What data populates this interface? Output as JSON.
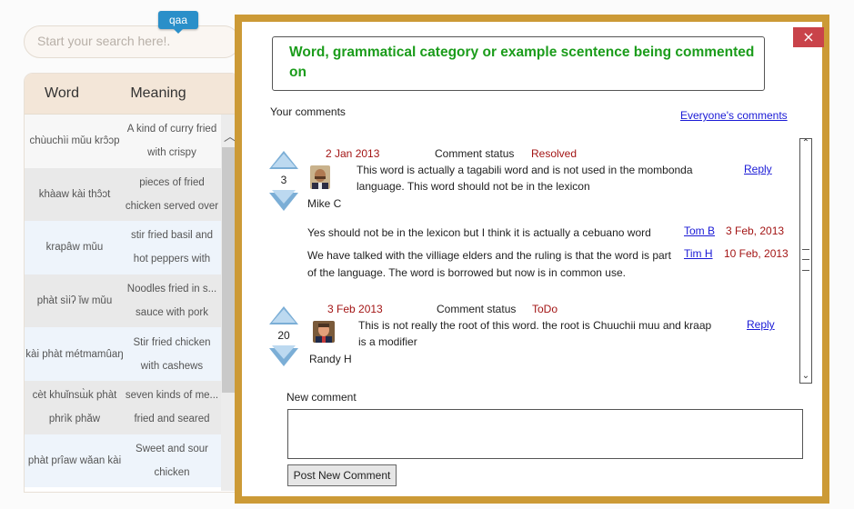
{
  "background": {
    "search_placeholder": "Start your search here!.",
    "badge": "qaa",
    "table": {
      "headers": {
        "word": "Word",
        "meaning": "Meaning"
      },
      "rows": [
        {
          "word": "chùuchìi mǔu krɔ̂ɔp",
          "meaning": "A kind of curry fried with crispy"
        },
        {
          "word": "khàaw kài thɔ̂ɔt",
          "meaning": "pieces of fried chicken served over"
        },
        {
          "word": "krapâw mǔu",
          "meaning": "stir fried basil and hot peppers with"
        },
        {
          "word": "phàt sìiʔ ǐw mǔu",
          "meaning": "Noodles fried in s... sauce with pork"
        },
        {
          "word": "kài phàt métmamûaŋ",
          "meaning": "Stir fried chicken with cashews"
        },
        {
          "word": "cèt khuǐnsɯ̀k phàt phrìk phǎw",
          "meaning": "seven kinds of me... fried and seared"
        },
        {
          "word": "phàt prîaw wǎan kài",
          "meaning": "Sweet and sour chicken"
        }
      ]
    }
  },
  "modal": {
    "close_label": "×",
    "subject": "Word, grammatical category or example scentence being commented on",
    "your_comments_label": "Your comments",
    "everyones_comments_link": "Everyone's comments",
    "comments": [
      {
        "date": "2 Jan 2013",
        "status_label": "Comment status",
        "status": "Resolved",
        "votes": "3",
        "author": "Mike C",
        "text": "This word is actually a tagabili word and is not used in the mombonda language. This word should not be in the lexicon",
        "reply_label": "Reply",
        "replies": [
          {
            "text": "Yes should not be in the lexicon but I think it is actually a cebuano word",
            "author": "Tom B",
            "date": "3 Feb, 2013"
          },
          {
            "text": "We have talked with the villiage elders and the ruling is that the word is part of the language. The word is borrowed but now is in common use.",
            "author": "Tim H",
            "date": "10 Feb, 2013"
          }
        ]
      },
      {
        "date": "3 Feb 2013",
        "status_label": "Comment status",
        "status": "ToDo",
        "votes": "20",
        "author": "Randy H",
        "text": "This is not really the root of this word. the root is Chuuchii muu and kraap is a modifier",
        "reply_label": "Reply",
        "replies": []
      }
    ],
    "new_comment_label": "New comment",
    "post_button": "Post New Comment"
  }
}
